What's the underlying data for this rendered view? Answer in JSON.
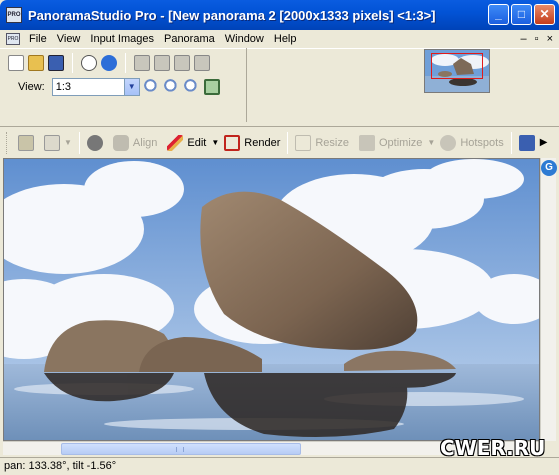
{
  "window": {
    "title": "PanoramaStudio Pro - [New panorama 2 [2000x1333 pixels] <1:3>]",
    "app_icon_text": "PRO",
    "minimize": "_",
    "maximize": "□",
    "close": "✕"
  },
  "menu": {
    "items": [
      "File",
      "View",
      "Input Images",
      "Panorama",
      "Window",
      "Help"
    ],
    "mdi": [
      "–",
      "▫",
      "×"
    ]
  },
  "toolbar": {
    "view_label": "View:",
    "view_value": "1:3"
  },
  "main_toolbar": {
    "align": "Align",
    "edit": "Edit",
    "render": "Render",
    "resize": "Resize",
    "optimize": "Optimize",
    "hotspots": "Hotspots"
  },
  "status": {
    "text": "pan: 133.38°, tilt -1.56°"
  },
  "watermark": {
    "text": "CWER.RU"
  },
  "colors": {
    "title_blue": "#0253d6",
    "sky": "#6f9fd8",
    "rock": "#8b735c"
  }
}
